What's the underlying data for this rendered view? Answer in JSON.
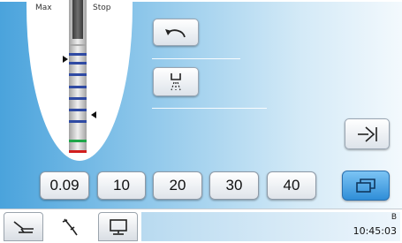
{
  "gauge": {
    "max_label": "Max",
    "stop_label": "Stop"
  },
  "side_buttons": {
    "undo_icon": "undo-arrow-icon",
    "spray_icon": "spray-icon",
    "enter_icon": "enter-arrow-icon"
  },
  "value_buttons": [
    "0.09",
    "10",
    "20",
    "30",
    "40"
  ],
  "window_button": {
    "icon": "window-switch-icon"
  },
  "tabs": [
    {
      "icon": "chair-icon"
    },
    {
      "icon": "instrument-icon",
      "active": true
    },
    {
      "icon": "monitor-icon"
    }
  ],
  "status": {
    "mode": "B",
    "time": "10:45:03"
  },
  "colors": {
    "accent_blue": "#2f8ed8",
    "tick_blue": "#2f4aa3",
    "tick_green": "#1fa64a",
    "tick_red": "#d21e1e"
  }
}
